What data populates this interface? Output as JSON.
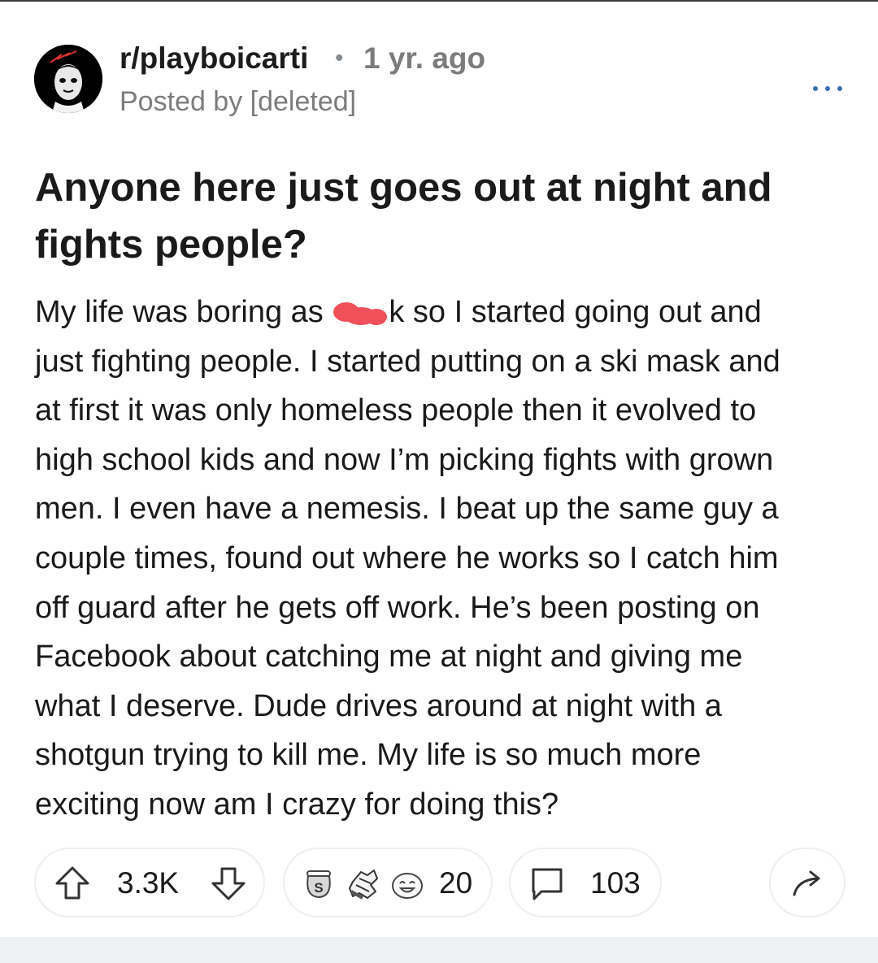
{
  "post": {
    "subreddit": "r/playboicarti",
    "separator": "•",
    "time_ago": "1 yr. ago",
    "posted_by": "Posted by [deleted]",
    "title_lines": [
      "Anyone here just goes out at night and",
      "fights people?"
    ],
    "body_first_line": {
      "before_redaction": "My life was boring as ",
      "after_redaction": "k so I started going out and"
    },
    "body_lines": [
      "just fighting people. I started putting on a ski mask and",
      "at first it was only homeless people then it evolved to",
      "high school kids and now I’m picking fights with grown",
      "men. I even have a nemesis. I beat up the same guy a",
      "couple times, found out where he works so I catch him",
      "off guard after he gets off work. He’s been posting on",
      "Facebook about catching me at night and giving me",
      "what I deserve. Dude drives around at night with a",
      "shotgun trying to kill me. My life is so much more",
      "exciting now am I crazy for doing this?"
    ]
  },
  "actions": {
    "votes": "3.3K",
    "awards_count": "20",
    "comments": "103"
  },
  "icons": {
    "avatar": "avatar-image",
    "more": "more-options-icon",
    "upvote": "upvote-arrow-icon",
    "downvote": "downvote-arrow-icon",
    "awards": [
      "silver-award-icon",
      "facepalm-award-icon",
      "laughing-award-icon"
    ],
    "comment": "comment-bubble-icon",
    "share": "share-arrow-icon"
  },
  "colors": {
    "text": "#1a1a1b",
    "meta_gray": "#7c7c7c",
    "more_dots": "#3a6fb0",
    "redaction": "#f0505a",
    "pill_border": "#eceef0"
  }
}
